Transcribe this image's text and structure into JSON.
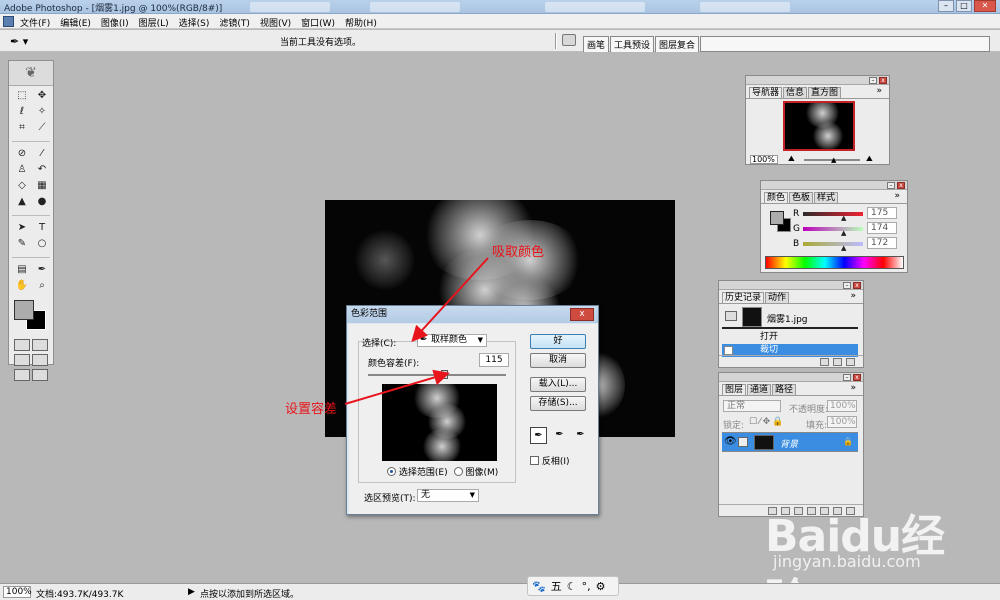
{
  "window": {
    "title": "Adobe Photoshop - [烟雾1.jpg @ 100%(RGB/8#)]"
  },
  "menu": {
    "items": [
      "文件(F)",
      "编辑(E)",
      "图像(I)",
      "图层(L)",
      "选择(S)",
      "滤镜(T)",
      "视图(V)",
      "窗口(W)",
      "帮助(H)"
    ]
  },
  "options": {
    "hint": "当前工具没有选项。",
    "wells": [
      "画笔",
      "工具预设",
      "图层复合"
    ]
  },
  "dialog": {
    "title": "色彩范围",
    "select_label": "选择(C):",
    "select_value": "取样颜色",
    "fuzziness_label": "颜色容差(F):",
    "fuzziness_value": "115",
    "fuzziness_slider_fraction": 0.55,
    "radio_selection": "选择范围(E)",
    "radio_image": "图像(M)",
    "selection_preview_label": "选区预览(T):",
    "selection_preview_value": "无",
    "ok": "好",
    "cancel": "取消",
    "load": "载入(L)...",
    "save": "存储(S)...",
    "invert": "反相(I)",
    "close": "x"
  },
  "annotations": {
    "pick_color": "吸取颜色",
    "set_tolerance": "设置容差"
  },
  "navigator": {
    "tabs": [
      "导航器",
      "信息",
      "直方图"
    ],
    "zoom": "100%"
  },
  "color_panel": {
    "tabs": [
      "颜色",
      "色板",
      "样式"
    ],
    "r_label": "R",
    "g_label": "G",
    "b_label": "B",
    "r": "175",
    "g": "174",
    "b": "172"
  },
  "history": {
    "tabs": [
      "历史记录",
      "动作"
    ],
    "snapshot": "烟雾1.jpg",
    "items": [
      "打开",
      "裁切"
    ]
  },
  "layers": {
    "tabs": [
      "图层",
      "通道",
      "路径"
    ],
    "blend_mode": "正常",
    "opacity_label": "不透明度:",
    "opacity": "100%",
    "lock_label": "锁定:",
    "fill_label": "填充:",
    "fill": "100%",
    "layer_name": "背景"
  },
  "status": {
    "zoom": "100%",
    "doc": "文档:493.7K/493.7K",
    "message": "点按以添加到所选区域。"
  },
  "ime": {
    "mode": "五"
  },
  "watermark": {
    "logo": "Baidu经验",
    "url": "jingyan.baidu.com"
  },
  "colors": {
    "annotation": "#e8141b",
    "selection": "#3b8de2",
    "nav_frame": "#c32226"
  }
}
